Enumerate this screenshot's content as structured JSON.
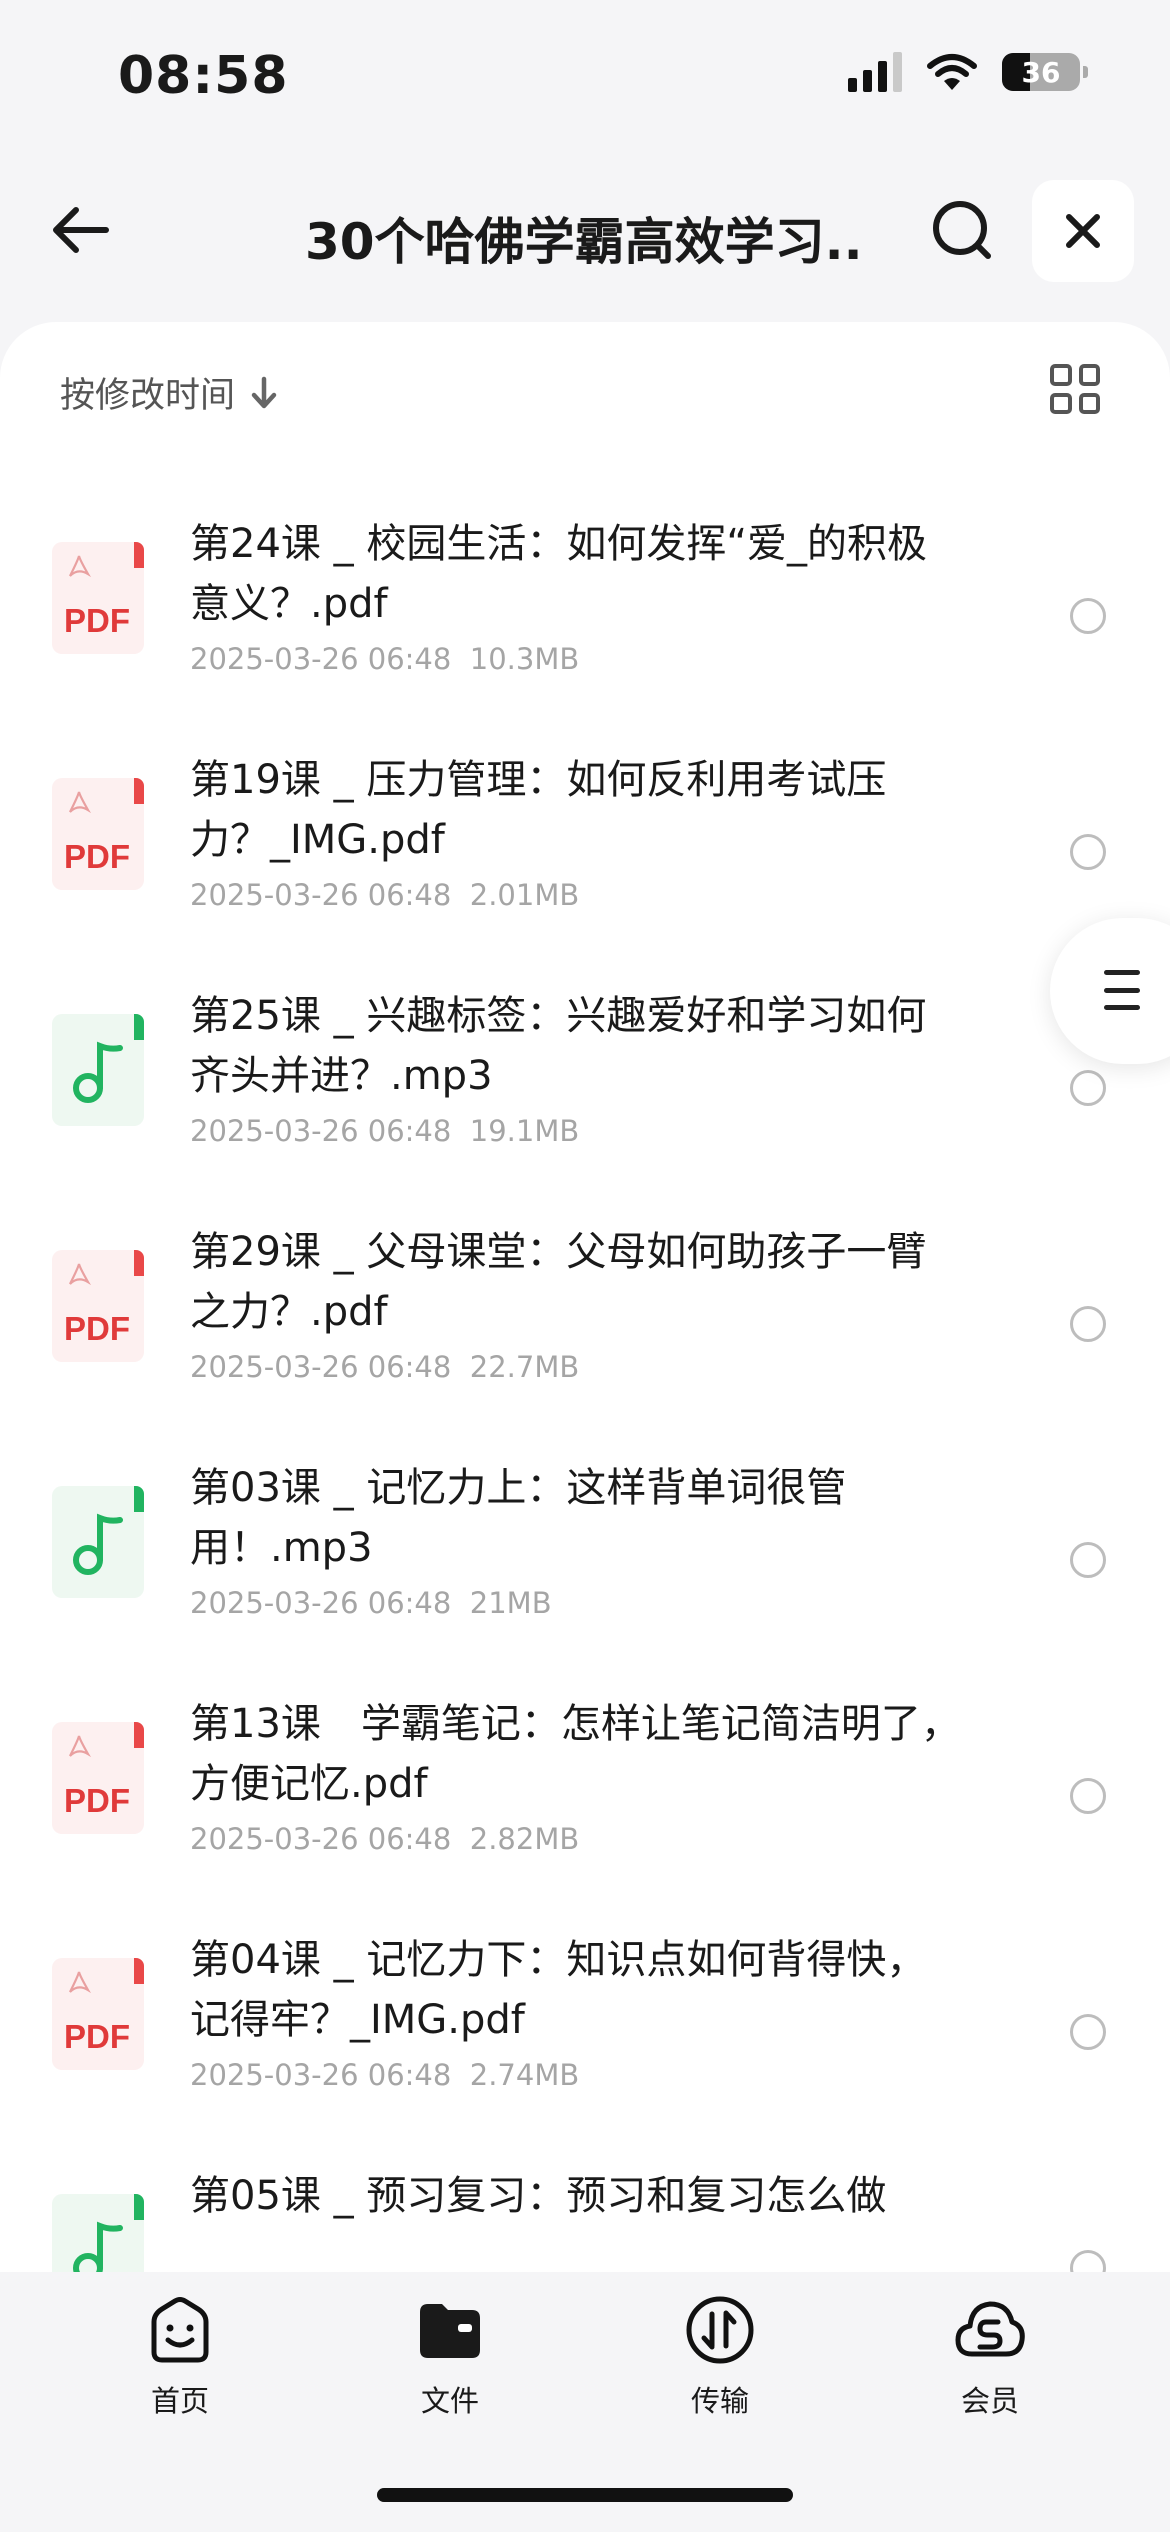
{
  "status_bar": {
    "time": "08:58",
    "battery": "36"
  },
  "nav": {
    "title": "30个哈佛学霸高效学习..."
  },
  "toolbar": {
    "sort_label": "按修改时间"
  },
  "files": [
    {
      "type": "pdf",
      "icon": "pdf-file-icon",
      "name": "第24课 _ 校园生活：如何发挥“爱_的积极意义？.pdf",
      "date": "2025-03-26 06:48",
      "size": "10.3MB"
    },
    {
      "type": "pdf",
      "icon": "pdf-file-icon",
      "name": "第19课 _ 压力管理：如何反利用考试压力？_IMG.pdf",
      "date": "2025-03-26 06:48",
      "size": "2.01MB"
    },
    {
      "type": "mp3",
      "icon": "audio-file-icon",
      "name": "第25课 _ 兴趣标签：兴趣爱好和学习如何齐头并进？.mp3",
      "date": "2025-03-26 06:48",
      "size": "19.1MB"
    },
    {
      "type": "pdf",
      "icon": "pdf-file-icon",
      "name": "第29课 _ 父母课堂：父母如何助孩子一臂之力？.pdf",
      "date": "2025-03-26 06:48",
      "size": "22.7MB"
    },
    {
      "type": "mp3",
      "icon": "audio-file-icon",
      "name": "第03课 _ 记忆力上：这样背单词很管用！.mp3",
      "date": "2025-03-26 06:48",
      "size": "21MB"
    },
    {
      "type": "pdf",
      "icon": "pdf-file-icon",
      "name": "第13课　学霸笔记：怎样让笔记简洁明了，方便记忆.pdf",
      "date": "2025-03-26 06:48",
      "size": "2.82MB"
    },
    {
      "type": "pdf",
      "icon": "pdf-file-icon",
      "name": "第04课 _ 记忆力下：知识点如何背得快，记得牢？_IMG.pdf",
      "date": "2025-03-26 06:48",
      "size": "2.74MB"
    },
    {
      "type": "mp3",
      "icon": "audio-file-icon",
      "name": "第05课 _ 预习复习：预习和复习怎么做",
      "date": "",
      "size": ""
    }
  ],
  "pdf_badge": "PDF",
  "tabs": [
    {
      "label": "首页",
      "icon": "home-smile-icon"
    },
    {
      "label": "文件",
      "icon": "folder-icon"
    },
    {
      "label": "传输",
      "icon": "transfer-icon"
    },
    {
      "label": "会员",
      "icon": "vip-cloud-icon"
    }
  ],
  "colors": {
    "pdf_red": "#e03a3a",
    "audio_green": "#21b460",
    "background": "#f5f5f7"
  }
}
